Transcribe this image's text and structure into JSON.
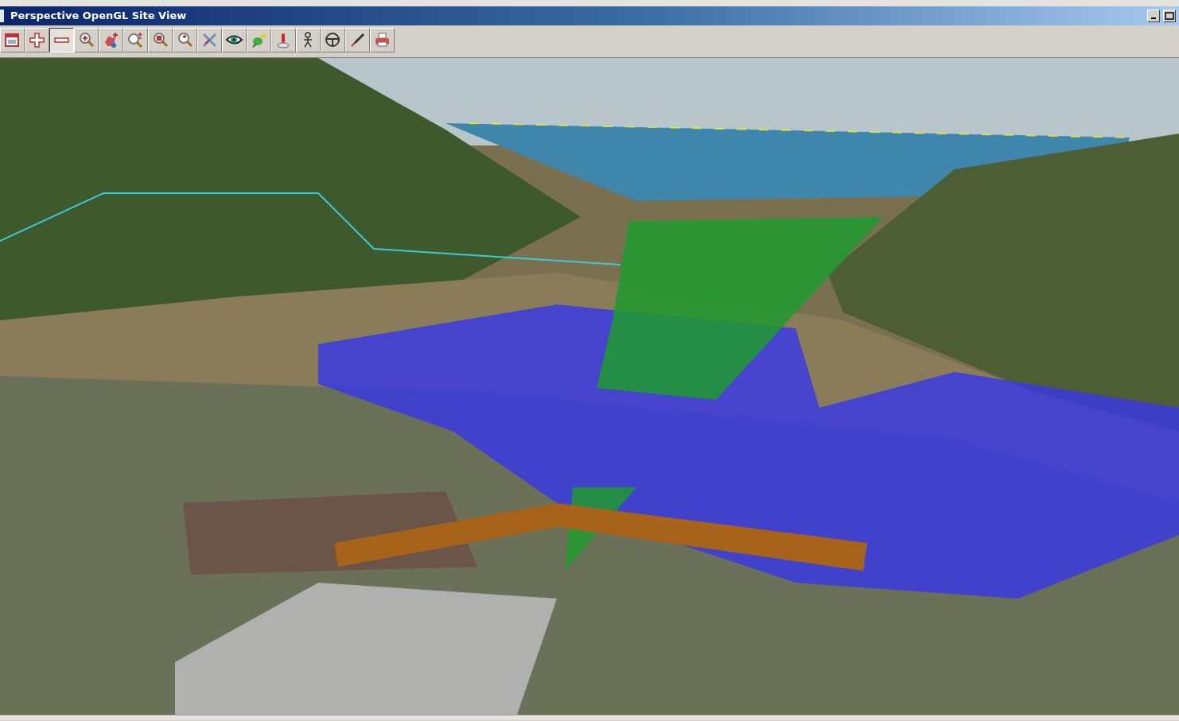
{
  "window": {
    "title": "Perspective OpenGL Site View"
  },
  "toolbar": [
    {
      "kind": "window",
      "pressed": false
    },
    {
      "kind": "plus",
      "pressed": false
    },
    {
      "kind": "minus",
      "pressed": true
    },
    {
      "kind": "zoom-in",
      "pressed": false
    },
    {
      "kind": "hand",
      "pressed": false
    },
    {
      "kind": "zoom-plusminus",
      "pressed": false
    },
    {
      "kind": "zoom-box",
      "pressed": false
    },
    {
      "kind": "zoom-point",
      "pressed": false
    },
    {
      "kind": "cross",
      "pressed": false
    },
    {
      "kind": "eye",
      "pressed": false
    },
    {
      "kind": "pin",
      "pressed": false
    },
    {
      "kind": "joystick",
      "pressed": false
    },
    {
      "kind": "person",
      "pressed": false
    },
    {
      "kind": "wheel",
      "pressed": false
    },
    {
      "kind": "pen",
      "pressed": false
    },
    {
      "kind": "printer",
      "pressed": false
    }
  ]
}
